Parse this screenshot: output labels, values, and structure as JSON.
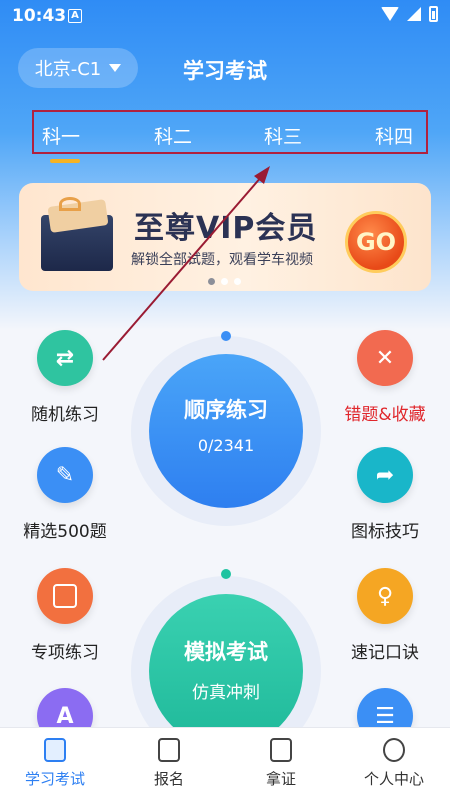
{
  "status_bar": {
    "time": "10:43",
    "notification_glyph": "A"
  },
  "header": {
    "city_label": "北京-C1",
    "title": "学习考试"
  },
  "subject_tabs": [
    {
      "label": "科一",
      "active": true
    },
    {
      "label": "科二",
      "active": false
    },
    {
      "label": "科三",
      "active": false
    },
    {
      "label": "科四",
      "active": false
    }
  ],
  "vip_banner": {
    "title": "至尊VIP会员",
    "subtitle": "解锁全部试题，观看学车视频",
    "button": "GO"
  },
  "features_left": [
    {
      "label": "随机练习",
      "icon": "shuffle-icon",
      "color": "#2fc4a0"
    },
    {
      "label": "精选500题",
      "icon": "edit-icon",
      "color": "#3b8ff5"
    },
    {
      "label": "专项练习",
      "icon": "folder-icon",
      "color": "#f2703f"
    },
    {
      "label": "",
      "icon": "font-icon",
      "color": "#8b6cf2"
    }
  ],
  "features_right": [
    {
      "label": "错题&收藏",
      "icon": "clipboard-x-icon",
      "color": "#f26a50",
      "label_color": "#e0262b"
    },
    {
      "label": "图标技巧",
      "icon": "signpost-icon",
      "color": "#19b6c9"
    },
    {
      "label": "速记口诀",
      "icon": "lightbulb-icon",
      "color": "#f5a623"
    },
    {
      "label": "",
      "icon": "notes-icon",
      "color": "#3b8ff5"
    }
  ],
  "sequence_practice": {
    "title": "顺序练习",
    "progress": "0/2341"
  },
  "mock_exam": {
    "title": "模拟考试",
    "subtitle": "仿真冲刺"
  },
  "bottom_nav": [
    {
      "label": "学习考试",
      "icon": "study-icon",
      "active": true
    },
    {
      "label": "报名",
      "icon": "id-card-icon",
      "active": false
    },
    {
      "label": "拿证",
      "icon": "certificate-icon",
      "active": false
    },
    {
      "label": "个人中心",
      "icon": "profile-icon",
      "active": false
    }
  ],
  "colors": {
    "primary": "#2d7ff2",
    "annotation": "#b0213f"
  }
}
